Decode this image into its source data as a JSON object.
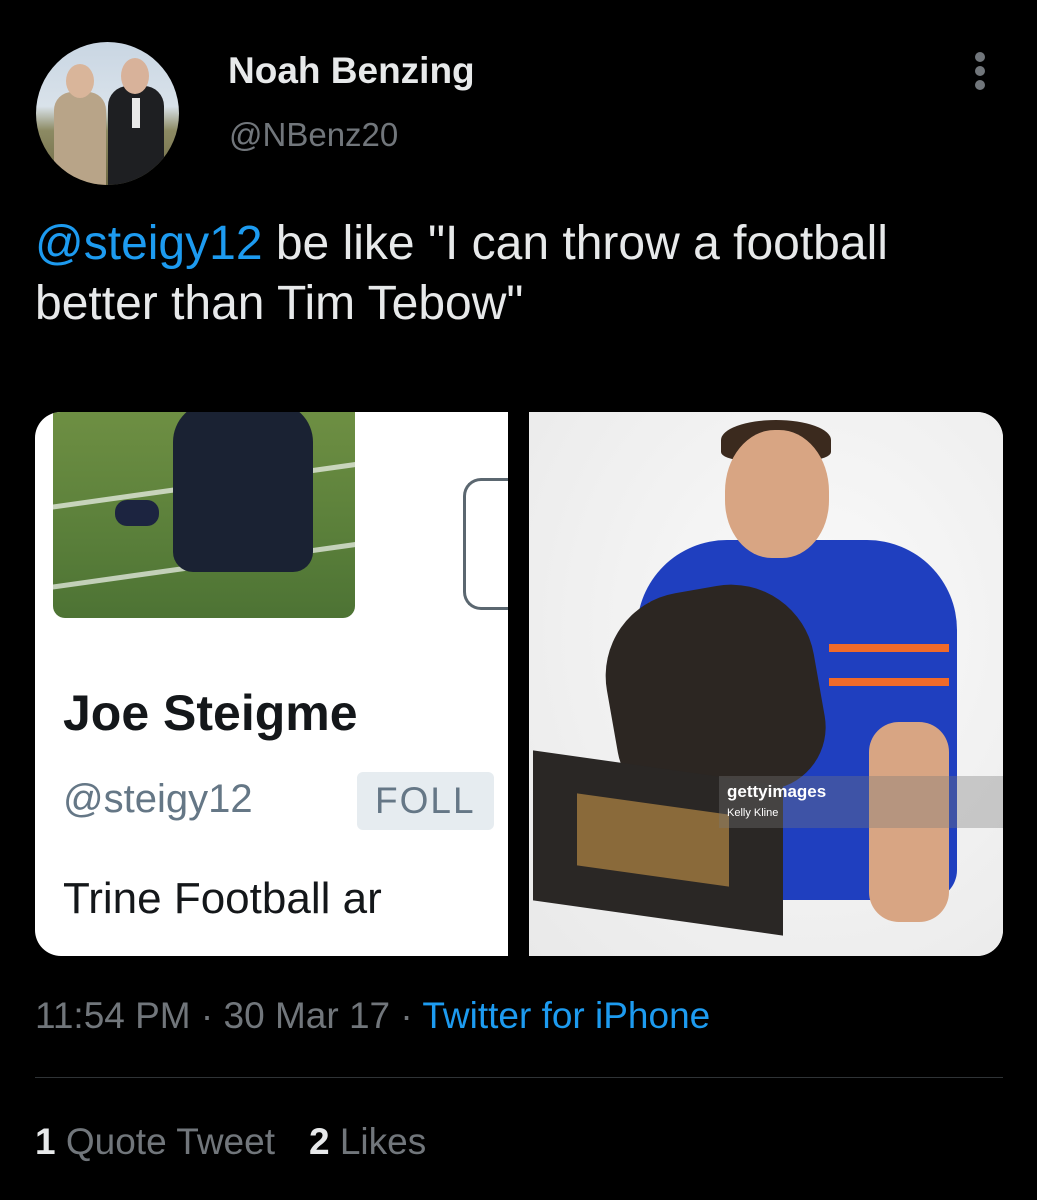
{
  "author": {
    "display_name": "Noah Benzing",
    "handle": "@NBenz20"
  },
  "tweet": {
    "mention": "@steigy12",
    "text": " be like \"I can throw a football better than Tim Tebow\""
  },
  "media": {
    "left_screenshot": {
      "name": "Joe Steigme",
      "handle": "@steigy12",
      "follows_badge": "FOLL",
      "bio": "Trine Football ar"
    },
    "right_photo": {
      "watermark": "gettyimages",
      "credit": "Kelly Kline"
    }
  },
  "meta": {
    "time": "11:54 PM",
    "separator": " · ",
    "date": "30 Mar 17",
    "source": "Twitter for iPhone"
  },
  "stats": {
    "quote_count": "1",
    "quote_label": " Quote Tweet",
    "like_count": "2",
    "like_label": " Likes"
  },
  "colors": {
    "background": "#000000",
    "link": "#1d9bf0",
    "secondary_text": "#71767b"
  }
}
